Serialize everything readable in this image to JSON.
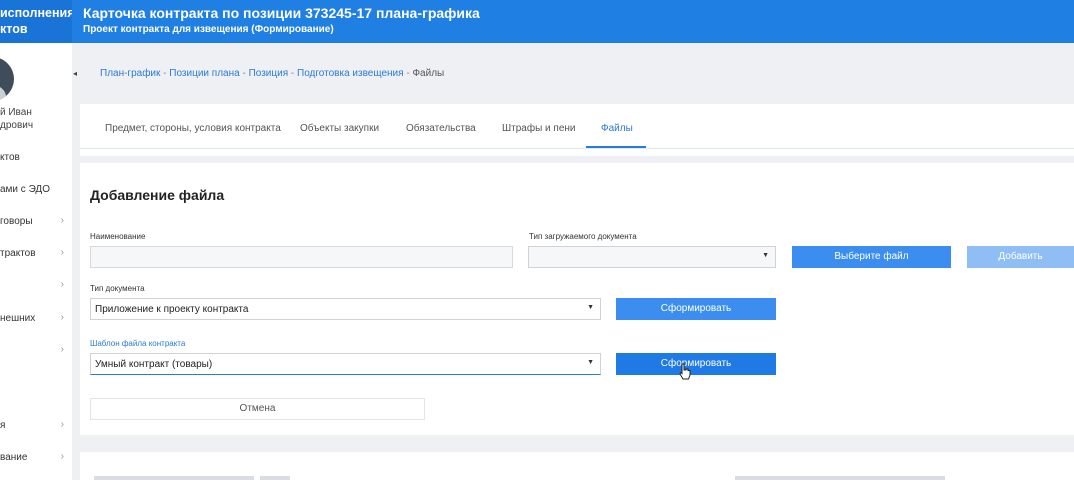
{
  "app": {
    "name_line1": "исполнения",
    "name_line2": "ктов",
    "title": "Карточка контракта по позиции 373245-17 плана-графика",
    "subtitle": "Проект контракта для извещения (Формирование)"
  },
  "sidebar": {
    "user_line1": "й Иван",
    "user_line2": "дрович",
    "items": [
      {
        "label": "ктов",
        "chevron": false
      },
      {
        "label": "ами с ЭДО",
        "chevron": false
      },
      {
        "label": "говоры",
        "chevron": true
      },
      {
        "label": "трактов",
        "chevron": true
      },
      {
        "label": "",
        "chevron": true
      },
      {
        "label": "нешних",
        "chevron": true
      },
      {
        "label": "",
        "chevron": true
      },
      {
        "label": "я",
        "chevron": true
      },
      {
        "label": "вание",
        "chevron": true
      }
    ],
    "chevron_glyph": "›",
    "collapse_glyph": "◂"
  },
  "breadcrumb": {
    "items": [
      "План-график",
      "Позиции плана",
      "Позиция",
      "Подготовка извещения"
    ],
    "separator": " - ",
    "current": "Файлы"
  },
  "tabs": [
    {
      "label": "Предмет, стороны, условия контракта",
      "active": false
    },
    {
      "label": "Объекты закупки",
      "active": false
    },
    {
      "label": "Обязательства",
      "active": false
    },
    {
      "label": "Штрафы и пени",
      "active": false
    },
    {
      "label": "Файлы",
      "active": true
    }
  ],
  "form": {
    "heading": "Добавление файла",
    "name_label": "Наименование",
    "name_value": "",
    "upload_type_label": "Тип загружаемого документа",
    "upload_type_value": "",
    "choose_file_button": "Выберите файл",
    "add_button": "Добавить",
    "doc_type_label": "Тип документа",
    "doc_type_value": "Приложение к проекту контракта",
    "generate_button_1": "Сформировать",
    "template_label": "Шаблон файла контракта",
    "template_value": "Умный контракт (товары)",
    "generate_button_2": "Сформировать",
    "cancel_button": "Отмена",
    "select_arrow": "▼"
  },
  "colors": {
    "header": "#1f7fe3",
    "accent": "#2a7bd8",
    "button": "#3b8ef0",
    "button_disabled": "#8fbef5"
  }
}
